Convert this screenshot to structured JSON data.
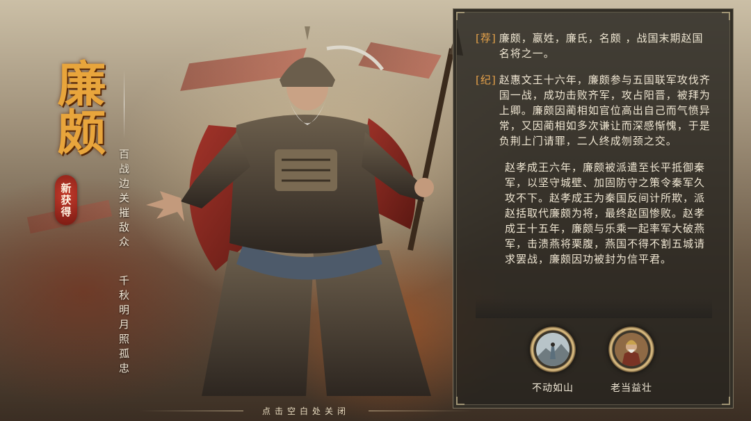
{
  "hero": {
    "name": "廉颇",
    "badge": "新获得",
    "poem_line1": "百战边关摧敌众",
    "poem_line2": "千秋明月照孤忠"
  },
  "bio": {
    "recommend_tag": "[荐]",
    "recommend_text": "廉颇，嬴姓，廉氏，名颇 ，战国末期赵国名将之一。",
    "record_tag": "[纪]",
    "record_text": "赵惠文王十六年，廉颇参与五国联军攻伐齐国一战，成功击败齐军，攻占阳晋，被拜为上卿。廉颇因蔺相如官位高出自己而气愤异常，又因蔺相如多次谦让而深感惭愧，于是负荆上门请罪，二人终成刎颈之交。",
    "record_text_2": "赵孝成王六年，廉颇被派遣至长平抵御秦军，以坚守城壁、加固防守之策令秦军久攻不下。赵孝成王为秦国反间计所欺，派赵括取代廉颇为将，最终赵国惨败。赵孝成王十五年，廉颇与乐乘一起率军大破燕军，击溃燕将栗腹，燕国不得不割五城请求罢战，廉颇因功被封为信平君。"
  },
  "skills": [
    {
      "name": "不动如山",
      "icon": "mountain-figure-icon"
    },
    {
      "name": "老当益壮",
      "icon": "veteran-general-icon"
    }
  ],
  "footer": {
    "close_hint": "点击空白处关闭"
  },
  "colors": {
    "title_gold": "#e8a53c",
    "tag_orange": "#e7a34a",
    "badge_red": "#c23a2b",
    "panel_bg": "#26231f"
  }
}
